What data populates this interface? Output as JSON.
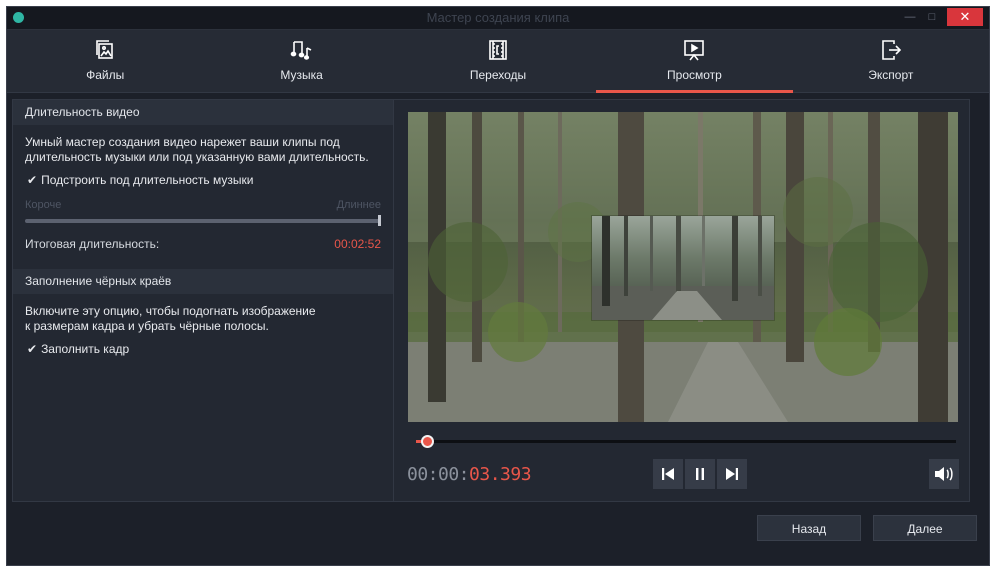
{
  "window": {
    "title": "Мастер создания клипа"
  },
  "nav": {
    "tabs": [
      {
        "label": "Файлы",
        "icon": "photo-file-icon"
      },
      {
        "label": "Музыка",
        "icon": "music-note-icon"
      },
      {
        "label": "Переходы",
        "icon": "transition-icon"
      },
      {
        "label": "Просмотр",
        "icon": "preview-play-icon"
      },
      {
        "label": "Экспорт",
        "icon": "export-icon"
      }
    ],
    "active_index": 3
  },
  "duration_section": {
    "header": "Длительность видео",
    "description": "Умный мастер создания видео нарежет ваши клипы под\nдлительность музыки или под указанную вами длительность.",
    "checkbox_label": "Подстроить под длительность музыки",
    "checkbox_checked": true,
    "slider_min_label": "Короче",
    "slider_max_label": "Длиннее",
    "slider_level": 1.0,
    "total_label": "Итоговая длительность:",
    "total_value": "00:02:52"
  },
  "fill_section": {
    "header": "Заполнение чёрных краёв",
    "description": "Включите эту опцию, чтобы подогнать изображение\nк размерам кадра и убрать чёрные полосы.",
    "checkbox_label": "Заполнить кадр",
    "checkbox_checked": true
  },
  "player": {
    "timecode_prefix": "00:00:",
    "timecode_value": "03.393",
    "progress": 0.02
  },
  "footer": {
    "back_label": "Назад",
    "next_label": "Далее"
  },
  "colors": {
    "accent": "#e8564a",
    "background": "#1c2029",
    "panel": "#232832"
  }
}
